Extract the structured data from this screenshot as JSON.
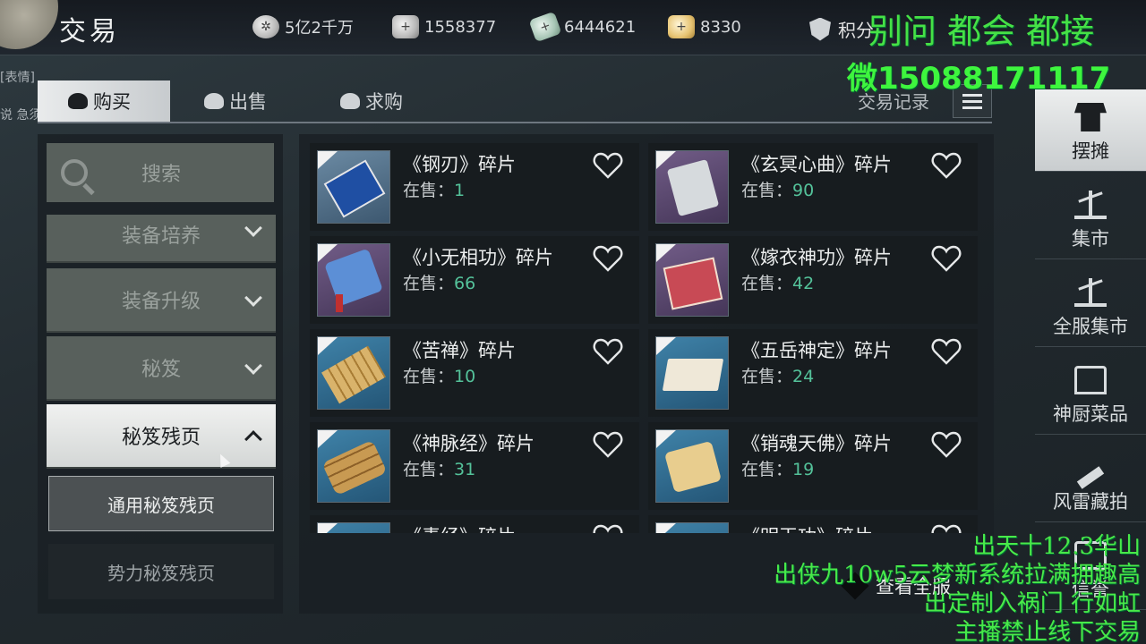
{
  "header": {
    "title": "交易",
    "currencies": [
      {
        "icon": "coin-wheel-icon",
        "value": "5亿2千万"
      },
      {
        "icon": "silver-ingot-icon",
        "value": "1558377"
      },
      {
        "icon": "jade-token-icon",
        "value": "6444621"
      },
      {
        "icon": "gold-ingot-icon",
        "value": "8330"
      }
    ],
    "score_label": "积分"
  },
  "left_edge_text": [
    "[表情]",
    "说 急须"
  ],
  "tabs": [
    {
      "label": "购买",
      "active": true
    },
    {
      "label": "出售",
      "active": false
    },
    {
      "label": "求购",
      "active": false
    }
  ],
  "trade_log": "交易记录",
  "search": {
    "label": "搜索"
  },
  "categories": [
    {
      "label": "装备培养",
      "open": false
    },
    {
      "label": "装备升级",
      "open": false
    },
    {
      "label": "秘笈",
      "open": false
    },
    {
      "label": "秘笈残页",
      "open": true
    }
  ],
  "subcategories": [
    {
      "label": "通用秘笈残页",
      "active": true
    },
    {
      "label": "势力秘笈残页",
      "active": false
    }
  ],
  "stock_label": "在售：",
  "items": [
    {
      "name": "《钢刃》碎片",
      "stock": "1",
      "thumb": "blue"
    },
    {
      "name": "《玄冥心曲》碎片",
      "stock": "90",
      "thumb": "purple"
    },
    {
      "name": "《小无相功》碎片",
      "stock": "66",
      "thumb": "purple"
    },
    {
      "name": "《嫁衣神功》碎片",
      "stock": "42",
      "thumb": "purple"
    },
    {
      "name": "《苦禅》碎片",
      "stock": "10",
      "thumb": "teal"
    },
    {
      "name": "《五岳神定》碎片",
      "stock": "24",
      "thumb": "teal"
    },
    {
      "name": "《神脉经》碎片",
      "stock": "31",
      "thumb": "teal"
    },
    {
      "name": "《销魂天佛》碎片",
      "stock": "19",
      "thumb": "teal"
    },
    {
      "name": "《毒经》碎片",
      "stock": "",
      "thumb": "teal"
    },
    {
      "name": "《明玉功》碎片",
      "stock": "",
      "thumb": "teal"
    }
  ],
  "view_all": "查看全服",
  "rail": [
    {
      "label": "摆摊",
      "active": true,
      "icon": "stall-icon"
    },
    {
      "label": "集市",
      "active": false,
      "icon": "scale-icon"
    },
    {
      "label": "全服集市",
      "active": false,
      "icon": "scale-icon"
    },
    {
      "label": "神厨菜品",
      "active": false,
      "icon": "kitchen-icon"
    },
    {
      "label": "风雷藏拍",
      "active": false,
      "icon": "gavel-icon"
    },
    {
      "label": "信誉",
      "active": false,
      "icon": "reputation-icon"
    }
  ],
  "overlay": {
    "top_line": "别问 都会 都接",
    "phone_line": "微15088171117",
    "bottom_lines": [
      "出天十12.3华山",
      "出侠九10w5云梦新系统拉满拥趣高",
      "出定制入祸门 行如虹",
      "主播禁止线下交易"
    ]
  },
  "colors": {
    "stock_number": "#54c29a",
    "overlay_green": "#49e949"
  }
}
